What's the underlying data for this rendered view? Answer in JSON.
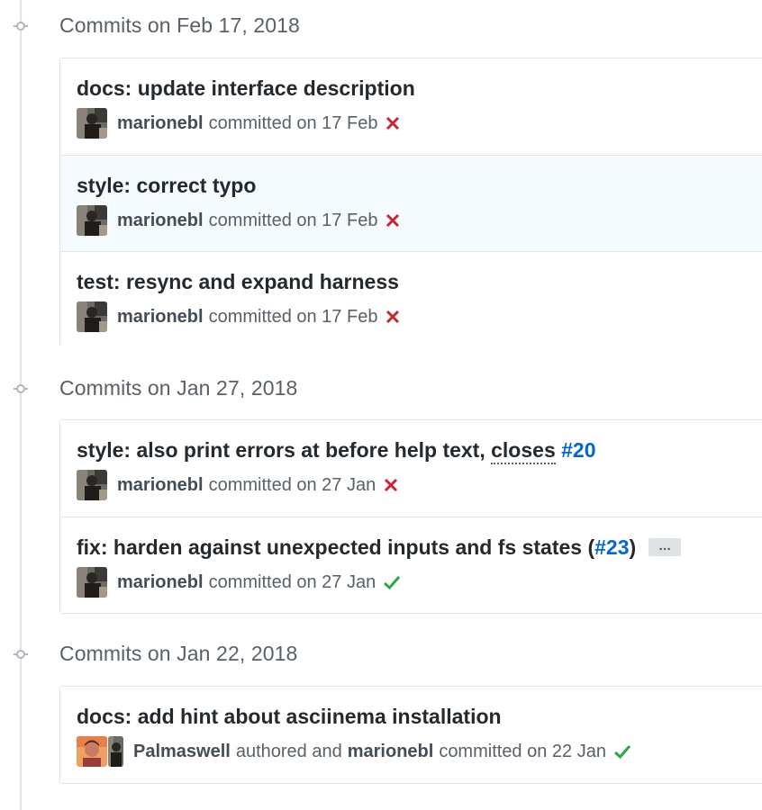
{
  "groups": [
    {
      "title": "Commits on Feb 17, 2018",
      "commits": [
        {
          "message": "docs: update interface description",
          "author": "marionebl",
          "committed_text": "committed on 17 Feb",
          "status": "failure"
        },
        {
          "message": "style: correct typo",
          "author": "marionebl",
          "committed_text": "committed on 17 Feb",
          "status": "failure"
        },
        {
          "message": "test: resync and expand harness",
          "author": "marionebl",
          "committed_text": "committed on 17 Feb",
          "status": "failure"
        }
      ]
    },
    {
      "title": "Commits on Jan 27, 2018",
      "commits": [
        {
          "message_prefix": "style: also print errors at before help text, ",
          "closes": "closes",
          "issue": "#20",
          "author": "marionebl",
          "committed_text": "committed on 27 Jan",
          "status": "failure"
        },
        {
          "message_prefix": "fix: harden against unexpected inputs and fs states (",
          "issue": "#23",
          "message_suffix": ")",
          "expander": "…",
          "author": "marionebl",
          "committed_text": "committed on 27 Jan",
          "status": "success"
        }
      ]
    },
    {
      "title": "Commits on Jan 22, 2018",
      "commits": [
        {
          "message": "docs: add hint about asciinema installation",
          "author": "Palmaswell",
          "authored_text": "authored and",
          "committer": "marionebl",
          "committed_text": "committed on 22 Jan",
          "status": "success"
        }
      ]
    }
  ],
  "icons": {
    "timeline_node": "git-commit-icon",
    "failure": "x-icon",
    "success": "check-icon"
  },
  "colors": {
    "failure": "#cb2431",
    "success": "#28a745",
    "link": "#0366d6",
    "highlight_row": "#f6fbff"
  }
}
